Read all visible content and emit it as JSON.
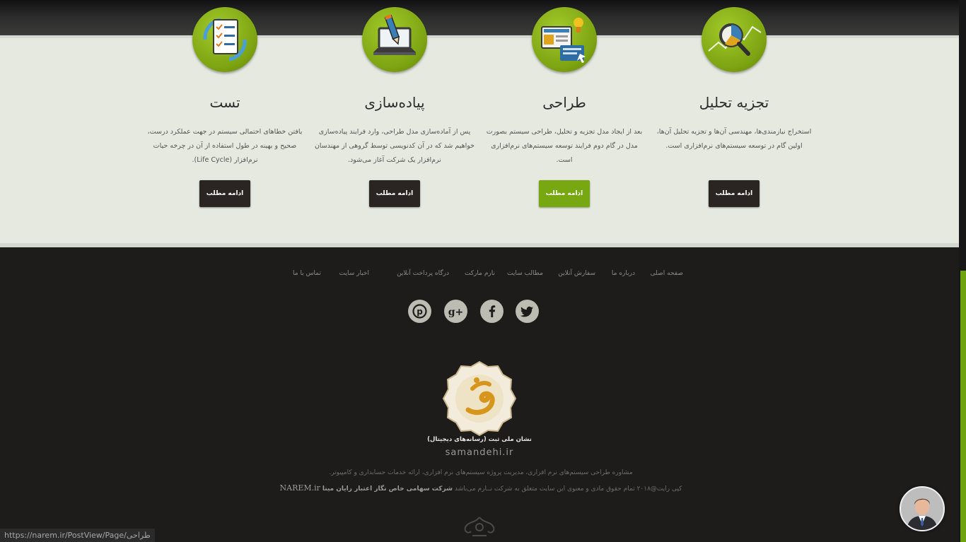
{
  "services": [
    {
      "title": "تجزیه تحلیل",
      "description": "استخراج نیازمندی‌ها، مهندسی آن‌ها و تجزیه تحلیل آن‌ها، اولین گام در توسعه سیستم‌های نرم‌افزاری است.",
      "button": "ادامه مطلب",
      "icon": "analysis-magnifier-icon"
    },
    {
      "title": "طراحی",
      "description": "بعد از ایجاد مدل تجزیه و تحلیل، طراحی سیستم بصورت مدل در گام دوم فرایند توسعه سیستم‌های نرم‌افزاری است.",
      "button": "ادامه مطلب",
      "icon": "design-screen-icon"
    },
    {
      "title": "پیاده‌سازی",
      "description": "پس از آماده‌سازی مدل طراحی، وارد فرایند پیاده‌سازی خواهیم شد که در آن کدنویسی توسط گروهی از مهندسان نرم‌افزار یک شرکت آغاز می‌شود.",
      "button": "ادامه مطلب",
      "icon": "laptop-pencil-icon"
    },
    {
      "title": "تست",
      "description": "یافتن خطاهای احتمالی سیستم در جهت عملکرد درست، صحیح و بهینه در طول استفاده از آن در چرخه حیات نرم‌افزار (Life Cycle).",
      "button": "ادامه مطلب",
      "icon": "checklist-icon"
    }
  ],
  "footer_menu": [
    "صفحه اصلی",
    "درباره ما",
    "سفارش آنلاین",
    "مطالب سایت",
    "نارم مارکت",
    "درگاه پرداخت آنلاین",
    "اخبار سایت",
    "تماس با ما"
  ],
  "social": [
    "twitter-icon",
    "facebook-icon",
    "google-plus-icon",
    "pinterest-icon"
  ],
  "seal": {
    "caption": "نشان ملی ثبت (رسانه‌های دیجیتال)",
    "domain": "samandehi.ir"
  },
  "footer_text": {
    "line1": "مشاوره طراحی سیستم‌های نرم افزاری، مدیریت پروژه سیستم‌های نرم افزاری، ارائه خدمات حسابداری و کامپیوتر.",
    "copyright_prefix": "کپی رایت@۲۰۱۸ تمام حقوق مادی و معنوی این سایت متعلق به شرکت نــارم می‌باشد",
    "company": "شرکت سهامی خاص نگار اعتبار رایان مینا",
    "brand": "NAREM.ir"
  },
  "status_url": "https://narem.ir/PostView/Page/طراحی",
  "colors": {
    "accent": "#78a811",
    "button_dark": "#2a2522",
    "band_bg": "#e5e9e0",
    "footer_bg": "#1d1c1b"
  }
}
